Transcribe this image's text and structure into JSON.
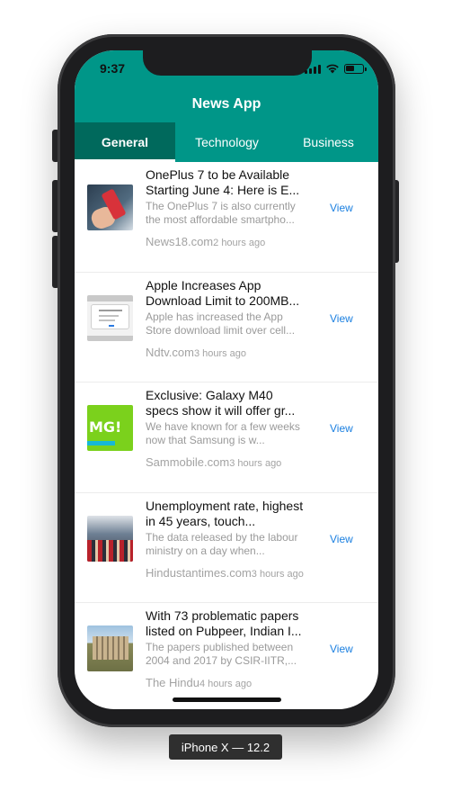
{
  "status_bar": {
    "time": "9:37",
    "icons": [
      "signal-icon",
      "wifi-icon",
      "battery-icon"
    ]
  },
  "app": {
    "title": "News App",
    "header_color": "#009688",
    "active_tab_color": "#00695c",
    "link_color": "#1a7fe0"
  },
  "tabs": [
    {
      "label": "General",
      "active": true
    },
    {
      "label": "Technology",
      "active": false
    },
    {
      "label": "Business",
      "active": false
    }
  ],
  "articles": [
    {
      "title": "OnePlus 7 to be Available Starting June 4: Here is E...",
      "description": "The OnePlus 7 is also currently the most affordable smartpho...",
      "source": "News18.com",
      "time": "2 hours ago",
      "action": "View",
      "thumbnail": "phone-in-hand-photo"
    },
    {
      "title": "Apple Increases App Download Limit to 200MB...",
      "description": "Apple has increased the App Store download limit over cell...",
      "source": "Ndtv.com",
      "time": "3 hours ago",
      "action": "View",
      "thumbnail": "ios-dialog-screenshot"
    },
    {
      "title": "Exclusive: Galaxy M40 specs show it will offer gr...",
      "description": "We have known for a few weeks now that Samsung is w...",
      "source": "Sammobile.com",
      "time": "3 hours ago",
      "action": "View",
      "thumbnail": "galaxy-m-banner"
    },
    {
      "title": "Unemployment rate, highest in 45 years, touch...",
      "description": "The data released by the labour ministry on a day when...",
      "source": "Hindustantimes.com",
      "time": "3 hours ago",
      "action": "View",
      "thumbnail": "crowd-photo"
    },
    {
      "title": "With 73 problematic papers listed on Pubpeer, Indian I...",
      "description": "The papers published between 2004 and 2017 by CSIR-IITR,...",
      "source": "The Hindu",
      "time": "4 hours ago",
      "action": "View",
      "thumbnail": "building-photo"
    }
  ],
  "device_caption": "iPhone X — 12.2"
}
